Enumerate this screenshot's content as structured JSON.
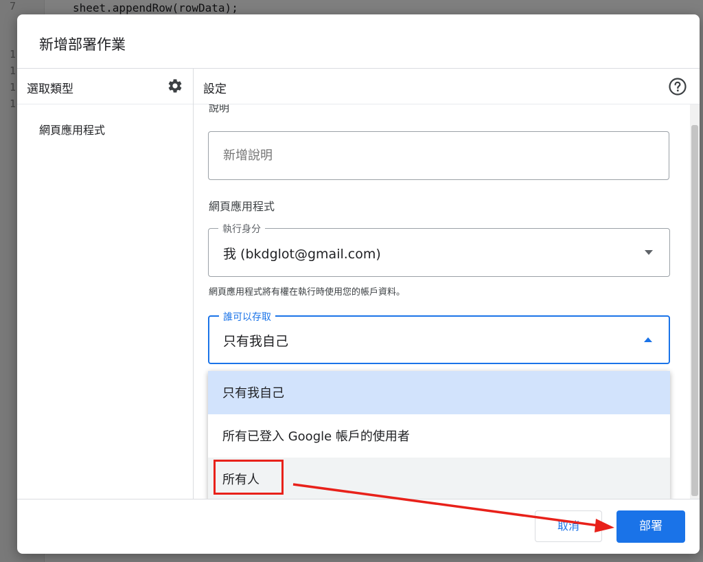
{
  "background_editor": {
    "line_number": "7",
    "code": "sheet.appendRow(rowData);",
    "gutter_numbers": [
      "1",
      "1",
      "1",
      "1"
    ]
  },
  "dialog": {
    "title": "新增部署作業",
    "sidebar": {
      "header": "選取類型",
      "settings_icon": "gear-icon",
      "items": [
        {
          "label": "網頁應用程式"
        }
      ]
    },
    "settings": {
      "header": "設定",
      "help_icon": "help-circle-icon",
      "description_label": "說明",
      "description_input": {
        "placeholder": "新增說明",
        "value": ""
      },
      "web_app_section": "網頁應用程式",
      "execute_as": {
        "label": "執行身分",
        "value": "我 (bkdglot@gmail.com)",
        "hint": "網頁應用程式將有權在執行時使用您的帳戶資料。"
      },
      "who_has_access": {
        "label": "誰可以存取",
        "value": "只有我自己",
        "options": [
          "只有我自己",
          "所有已登入 Google 帳戶的使用者",
          "所有人"
        ]
      }
    },
    "footer": {
      "cancel_label": "取消",
      "deploy_label": "部署"
    }
  },
  "annotation": {
    "highlight_color": "#e8211a"
  },
  "colors": {
    "accent": "#1a73e8",
    "selected_option_bg": "#d2e3fc"
  }
}
